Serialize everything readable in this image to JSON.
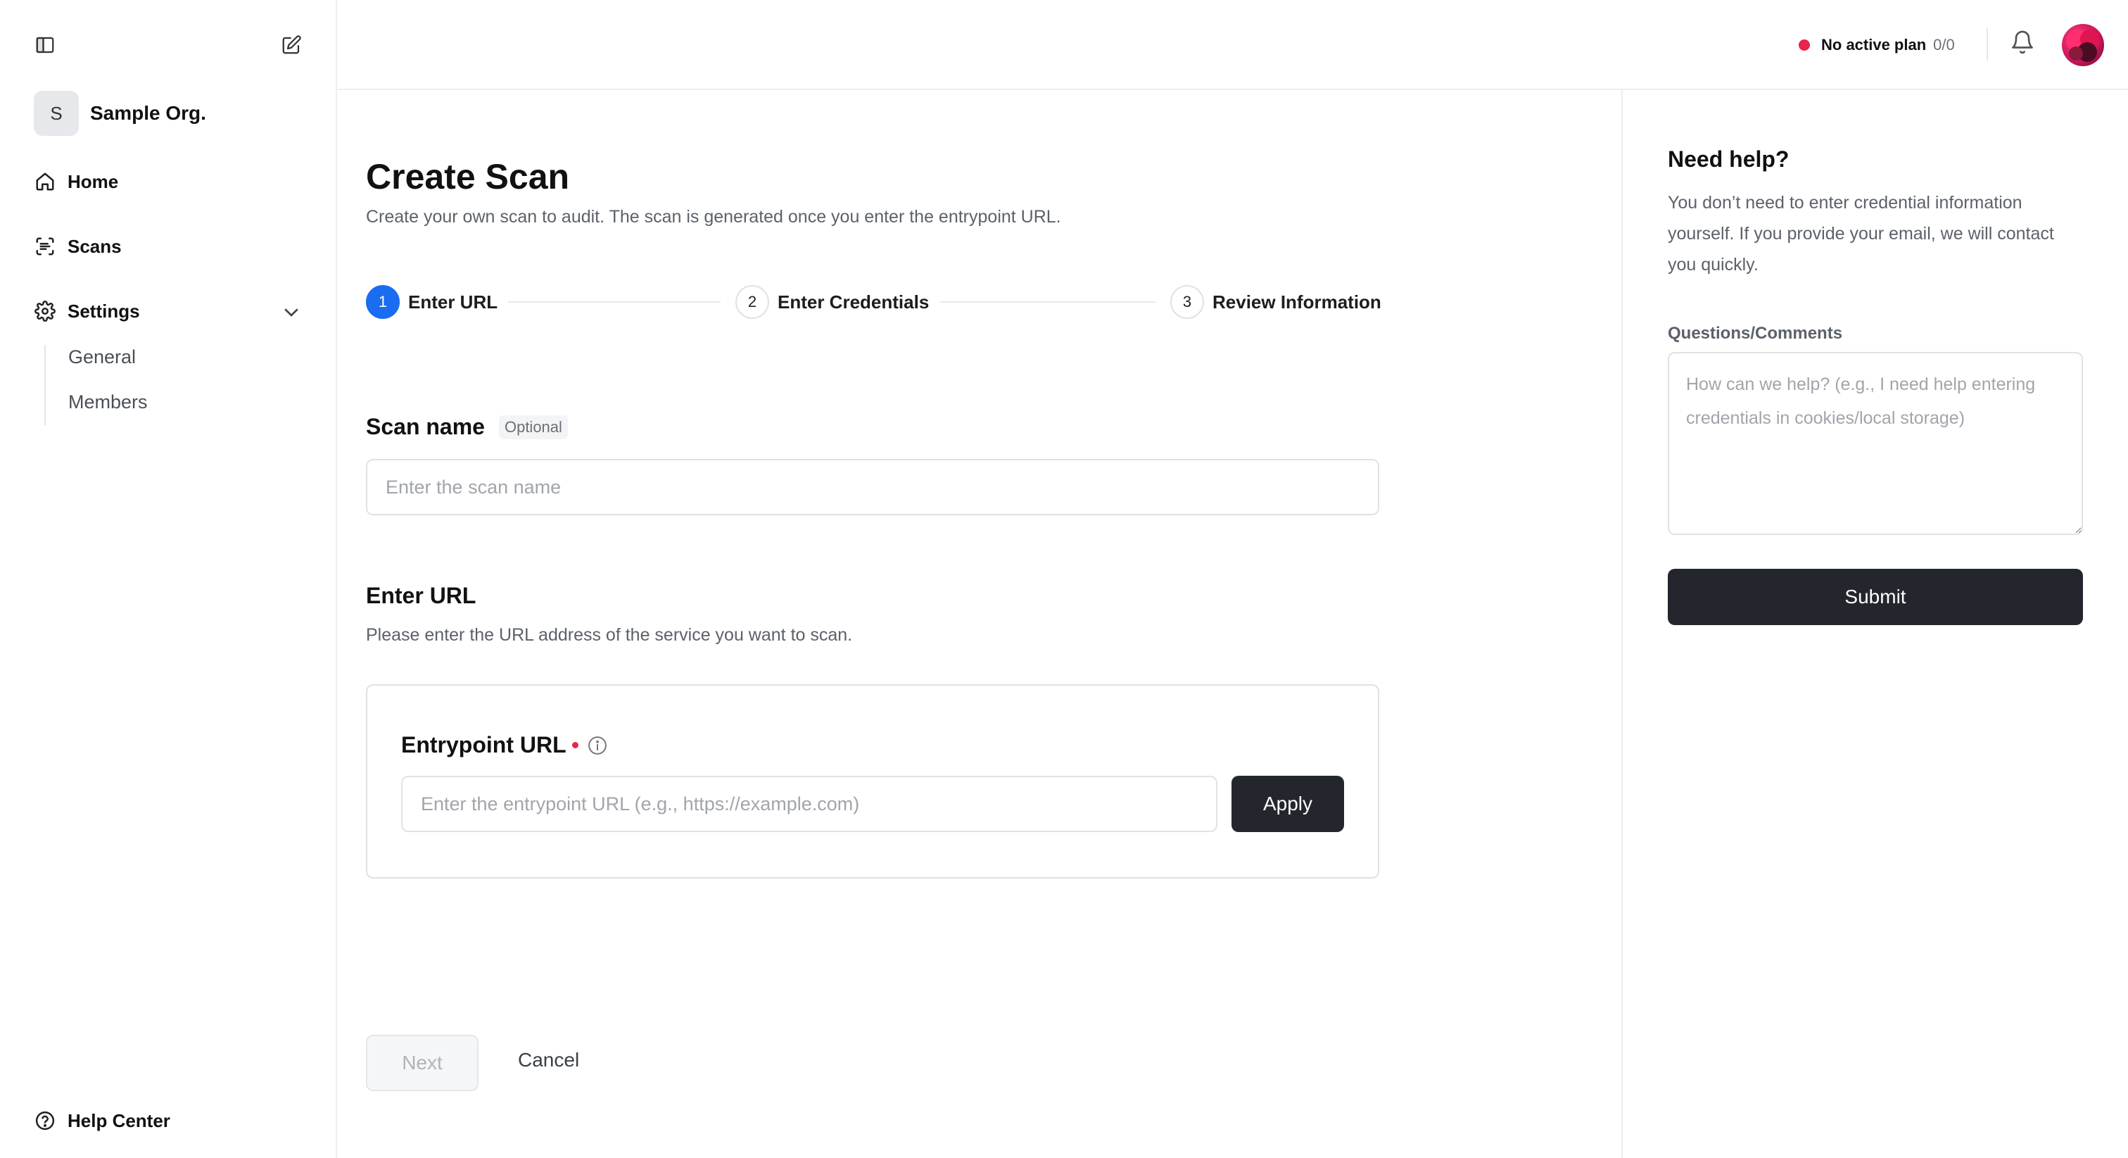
{
  "sidebar": {
    "org_initial": "S",
    "org_name": "Sample Org.",
    "nav": {
      "home": "Home",
      "scans": "Scans",
      "settings": "Settings"
    },
    "settings_sub": {
      "general": "General",
      "members": "Members"
    },
    "help_center": "Help Center"
  },
  "header": {
    "plan_label": "No active plan",
    "plan_count": "0/0"
  },
  "main": {
    "title": "Create Scan",
    "subtitle": "Create your own scan to audit. The scan is generated once you enter the entrypoint URL.",
    "steps": [
      {
        "number": "1",
        "label": "Enter URL"
      },
      {
        "number": "2",
        "label": "Enter Credentials"
      },
      {
        "number": "3",
        "label": "Review Information"
      }
    ],
    "scan_name_label": "Scan name",
    "scan_name_optional": "Optional",
    "scan_name_placeholder": "Enter the scan name",
    "enter_url_title": "Enter URL",
    "enter_url_desc": "Please enter the URL address of the service you want to scan.",
    "entrypoint_label": "Entrypoint URL",
    "entrypoint_placeholder": "Enter the entrypoint URL (e.g., https://example.com)",
    "apply_label": "Apply",
    "next_label": "Next",
    "cancel_label": "Cancel"
  },
  "help_panel": {
    "title": "Need help?",
    "description": "You don’t need to enter credential information yourself. If you provide your email, we will contact you quickly.",
    "comments_label": "Questions/Comments",
    "comments_placeholder": "How can we help? (e.g., I need help entering credentials in cookies/local storage)",
    "submit_label": "Submit"
  },
  "colors": {
    "accent": "#1a6cf0",
    "status_dot": "#e5254b",
    "dark_button": "#23272d"
  }
}
